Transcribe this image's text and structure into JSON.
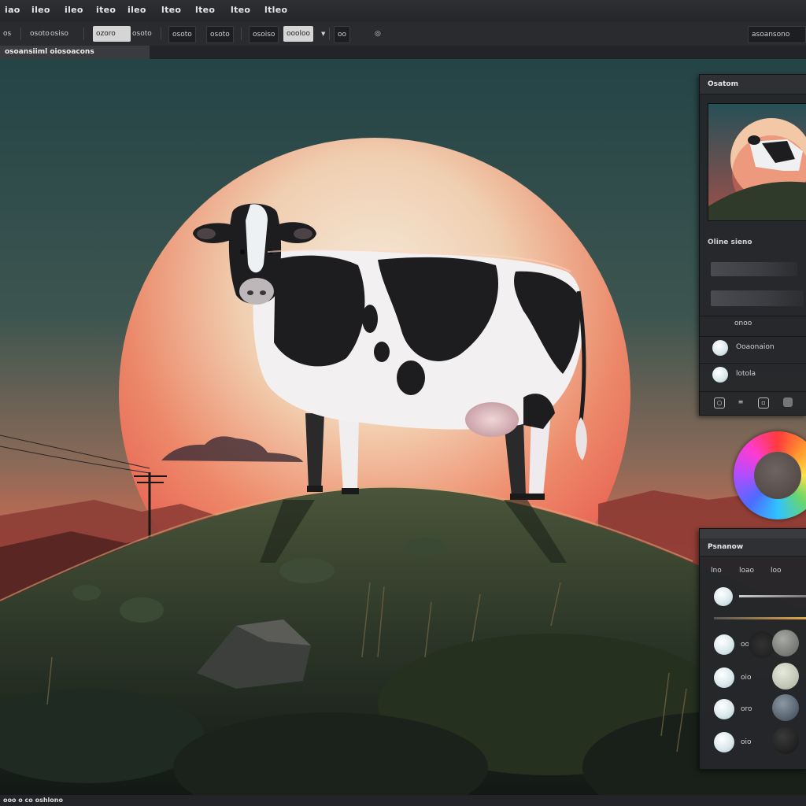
{
  "menu": {
    "items": [
      "iao",
      "ileo",
      "ileo",
      "iteo",
      "ileo",
      "lteo",
      "lteo",
      "lteo",
      "ltleo"
    ]
  },
  "options": {
    "items": [
      "os",
      "osoto",
      "osiso",
      "ozoro",
      "osoto",
      "osoto",
      "osoto",
      "osoiso",
      "oooloo",
      "oo"
    ],
    "right_button": "asoansono"
  },
  "tab": {
    "title": "osoansiiml oiosoacons"
  },
  "navigator": {
    "title": "Osatom",
    "row1_label": "Oline sieno"
  },
  "layers": {
    "rows": [
      "onoo",
      "Ooaonaion",
      "lotola"
    ]
  },
  "swatches": {
    "title": "Psnanow",
    "tabs": [
      "lno",
      "loao",
      "loo"
    ],
    "rows": [
      "oo",
      "oio",
      "oro",
      "oio"
    ]
  },
  "status": {
    "text": "ooo o co oshlono"
  },
  "colors": {
    "sky_top": "#27474a",
    "sun_center": "#f7e3c8",
    "sun_edge": "#e8524a",
    "hill": "#2f3a2a"
  },
  "icons": [
    "menu-icon",
    "circle-icon",
    "eye-icon",
    "lock-icon",
    "trash-icon"
  ]
}
